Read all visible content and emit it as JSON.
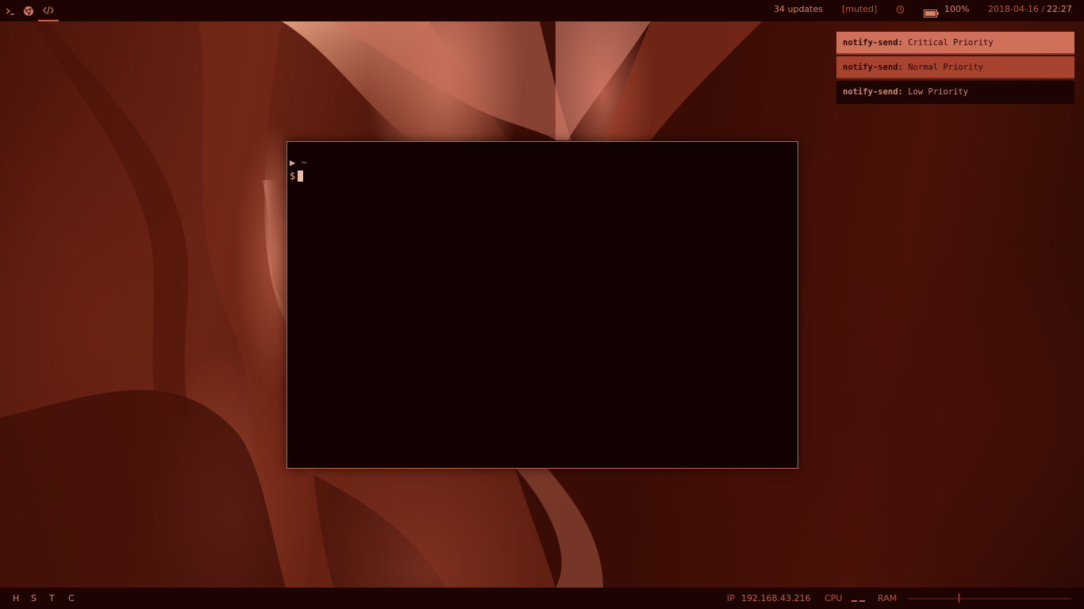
{
  "topbar": {
    "workspaces": [
      {
        "icon": "terminal-icon",
        "active": false
      },
      {
        "icon": "chrome-icon",
        "active": false
      },
      {
        "icon": "code-icon",
        "active": true
      }
    ],
    "updates": "34 updates",
    "volume": "[muted]",
    "clock_icon": "clock-icon",
    "battery_icon": "battery-icon",
    "battery": "100%",
    "date": "2018-04-16 /",
    "time": "22:27"
  },
  "notifications": [
    {
      "app": "notify-send:",
      "message": "Critical Priority",
      "urgency": "critical"
    },
    {
      "app": "notify-send:",
      "message": "Normal Priority",
      "urgency": "normal"
    },
    {
      "app": "notify-send:",
      "message": "Low Priority",
      "urgency": "low"
    }
  ],
  "terminal": {
    "prompt_arrow": "▶",
    "directory": "~",
    "prompt_symbol": "$"
  },
  "bottombar": {
    "tags": [
      "H",
      "S",
      "T",
      "C"
    ],
    "ip_label": "IP",
    "ip_value": "192.168.43.216",
    "cpu_label": "CPU",
    "ram_label": "RAM",
    "ram_level": 0.31
  },
  "colors": {
    "accent": "#c85d48",
    "bar_background": "#1d0403",
    "terminal_background": "#110101",
    "notif_critical": "#d0705a",
    "notif_normal": "#a8432f",
    "notif_low": "#1c0403"
  }
}
